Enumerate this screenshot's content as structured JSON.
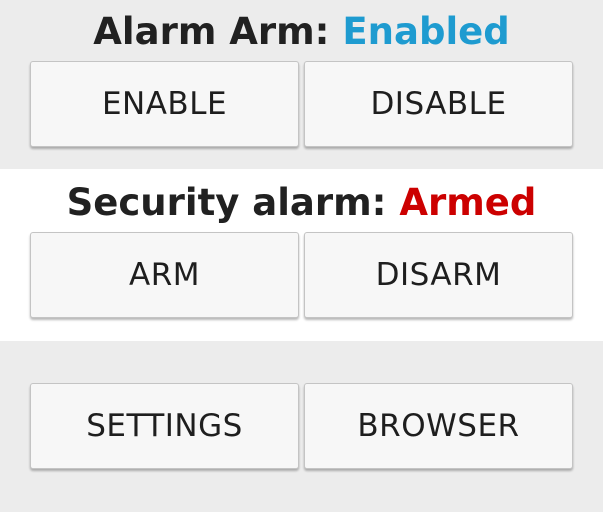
{
  "alarm_arm": {
    "label": "Alarm Arm: ",
    "status": "Enabled",
    "status_color": "#1e9bd0",
    "enable_label": "ENABLE",
    "disable_label": "DISABLE"
  },
  "security_alarm": {
    "label": "Security alarm: ",
    "status": "Armed",
    "status_color": "#cc0000",
    "arm_label": "ARM",
    "disarm_label": "DISARM"
  },
  "actions": {
    "settings_label": "SETTINGS",
    "browser_label": "BROWSER"
  }
}
